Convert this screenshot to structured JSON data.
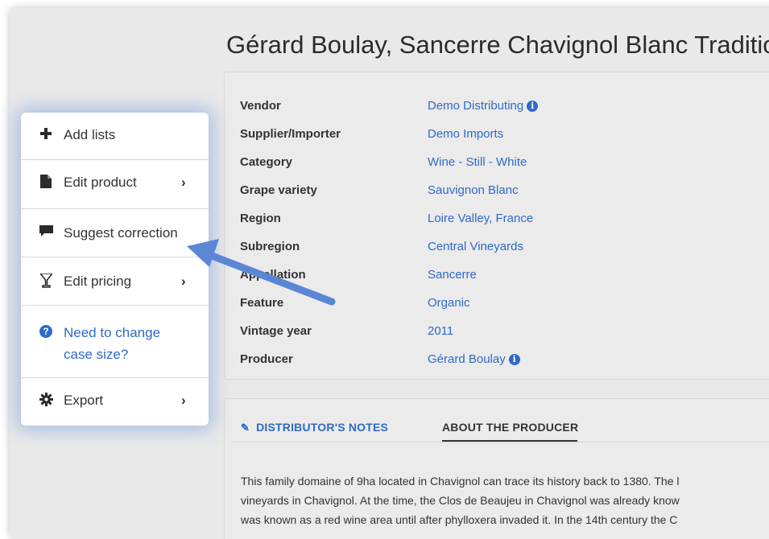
{
  "page": {
    "title": "Gérard Boulay, Sancerre Chavignol Blanc Tradition"
  },
  "details": [
    {
      "label": "Vendor",
      "value": "Demo Distributing",
      "info": true
    },
    {
      "label": "Supplier/Importer",
      "value": "Demo Imports"
    },
    {
      "label": "Category",
      "value": "Wine - Still - White"
    },
    {
      "label": "Grape variety",
      "value": "Sauvignon Blanc"
    },
    {
      "label": "Region",
      "value": "Loire Valley, France"
    },
    {
      "label": "Subregion",
      "value": "Central Vineyards"
    },
    {
      "label": "Appellation",
      "value": "Sancerre"
    },
    {
      "label": "Feature",
      "value": "Organic"
    },
    {
      "label": "Vintage year",
      "value": "2011"
    },
    {
      "label": "Producer",
      "value": "Gérard Boulay",
      "info": true
    }
  ],
  "tabs": {
    "notes": "DISTRIBUTOR'S NOTES",
    "producer": "ABOUT THE PRODUCER"
  },
  "about_text": [
    "This family domaine of 9ha located in Chavignol can trace its history back to 1380. The l",
    "vineyards in Chavignol. At the time, the Clos de Beaujeu in Chavignol was already know",
    "was known as a red wine area until after phylloxera invaded it. In the 14th century the C"
  ],
  "menu": {
    "add_lists": "Add lists",
    "edit_product": "Edit product",
    "suggest_correction": "Suggest correction",
    "edit_pricing": "Edit pricing",
    "change_case_size": "Need to change case size?",
    "export": "Export"
  },
  "icons": {
    "add": "plus-icon",
    "edit_product": "file-icon",
    "suggest": "comment-icon",
    "pricing": "glass-icon",
    "case_size": "question-circle-icon",
    "export": "gear-icon",
    "info": "info-circle-icon",
    "notes": "pencil-icon"
  },
  "colors": {
    "link": "#2f6ac6",
    "arrow": "#5b86d6",
    "background": "#e9e9e9"
  }
}
